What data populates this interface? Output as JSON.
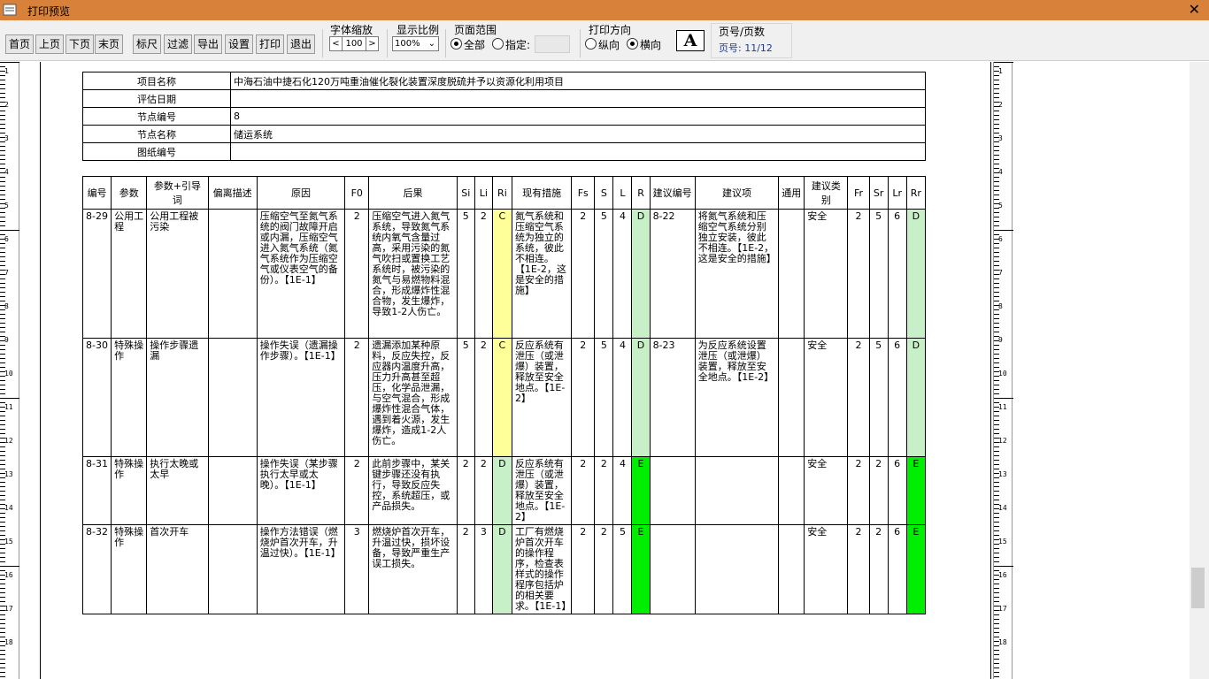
{
  "window": {
    "title": "打印预览"
  },
  "toolbar": {
    "buttons": [
      "首页",
      "上页",
      "下页",
      "末页",
      "标尺",
      "过滤",
      "导出",
      "设置",
      "打印",
      "退出"
    ],
    "font_scale_label": "字体缩放",
    "font_scale_dec": "<",
    "font_scale_value": "100",
    "font_scale_inc": ">",
    "zoom_label": "显示比例",
    "zoom_value": "100%",
    "range_label": "页面范围",
    "range_all": "全部",
    "range_spec": "指定:",
    "range_spec_value": "",
    "orient_label": "打印方向",
    "orient_portrait": "纵向",
    "orient_landscape": "横向",
    "page_label": "页号/页数",
    "page_value": "页号: 11/12",
    "font_icon": "A"
  },
  "info": [
    {
      "k": "项目名称",
      "v": "中海石油中捷石化120万吨重油催化裂化装置深度脱硫并予以资源化利用项目"
    },
    {
      "k": "评估日期",
      "v": ""
    },
    {
      "k": "节点编号",
      "v": "8"
    },
    {
      "k": "节点名称",
      "v": "储运系统"
    },
    {
      "k": "图纸编号",
      "v": ""
    }
  ],
  "columns": [
    "编号",
    "参数",
    "参数+引导词",
    "偏离描述",
    "原因",
    "F0",
    "后果",
    "Si",
    "Li",
    "Ri",
    "现有措施",
    "Fs",
    "S",
    "L",
    "R",
    "建议编号",
    "建议项",
    "通用",
    "建议类别",
    "Fr",
    "Sr",
    "Lr",
    "Rr"
  ],
  "rows": [
    {
      "id": "8-29",
      "param": "公用工程",
      "guide": "公用工程被污染",
      "dev": "",
      "cause": "压缩空气至氮气系统的阀门故障开启或内漏，压缩空气进入氮气系统（氮气系统作为压缩空气或仪表空气的备份）。【1E-1】",
      "f0": "2",
      "cons": "压缩空气进入氮气系统，导致氮气系统内氧气含量过高，采用污染的氮气吹扫或置换工艺系统时，被污染的氮气与易燃物料混合，形成爆炸性混合物，发生爆炸，导致1-2人伤亡。",
      "si": "5",
      "li": "2",
      "ri": "C",
      "meas": "氮气系统和压缩空气系统为独立的系统，彼此不相连。【1E-2，这是安全的措施】",
      "fs": "2",
      "s": "5",
      "l": "4",
      "r": "D",
      "rec_id": "8-22",
      "rec": "将氮气系统和压缩空气系统分别独立安装，彼此不相连。【1E-2，这是安全的措施】",
      "gen": "",
      "cat": "安全",
      "fr": "2",
      "sr": "5",
      "lr": "6",
      "rr": "D"
    },
    {
      "id": "8-30",
      "param": "特殊操作",
      "guide": "操作步骤遗漏",
      "dev": "",
      "cause": "操作失误（遗漏操作步骤）。【1E-1】",
      "f0": "2",
      "cons": "遗漏添加某种原料，反应失控，反应器内温度升高，压力升高甚至超压，化学品泄漏，与空气混合，形成爆炸性混合气体，遇到着火源，发生爆炸，造成1-2人伤亡。",
      "si": "5",
      "li": "2",
      "ri": "C",
      "meas": "反应系统有泄压（或泄爆）装置，释放至安全地点。【1E-2】",
      "fs": "2",
      "s": "5",
      "l": "4",
      "r": "D",
      "rec_id": "8-23",
      "rec": "为反应系统设置泄压（或泄爆）装置，释放至安全地点。【1E-2】",
      "gen": "",
      "cat": "安全",
      "fr": "2",
      "sr": "5",
      "lr": "6",
      "rr": "D"
    },
    {
      "id": "8-31",
      "param": "特殊操作",
      "guide": "执行太晚或太早",
      "dev": "",
      "cause": "操作失误（某步骤执行太早或太晚）。【1E-1】",
      "f0": "2",
      "cons": "此前步骤中，某关键步骤还没有执行，导致反应失控，系统超压，或产品损失。",
      "si": "2",
      "li": "2",
      "ri": "D",
      "meas": "反应系统有泄压（或泄爆）装置，释放至安全地点。【1E-2】",
      "fs": "2",
      "s": "2",
      "l": "4",
      "r": "E",
      "rec_id": "",
      "rec": "",
      "gen": "",
      "cat": "安全",
      "fr": "2",
      "sr": "2",
      "lr": "6",
      "rr": "E"
    },
    {
      "id": "8-32",
      "param": "特殊操作",
      "guide": "首次开车",
      "dev": "",
      "cause": "操作方法错误（燃烧炉首次开车，升温过快）。【1E-1】",
      "f0": "3",
      "cons": "燃烧炉首次开车，升温过快，损坏设备，导致严重生产误工损失。",
      "si": "2",
      "li": "3",
      "ri": "D",
      "meas": "工厂有燃烧炉首次开车的操作程序，检查表样式的操作程序包括炉的相关要求。【1E-1】",
      "fs": "2",
      "s": "2",
      "l": "5",
      "r": "E",
      "rec_id": "",
      "rec": "",
      "gen": "",
      "cat": "安全",
      "fr": "2",
      "sr": "2",
      "lr": "6",
      "rr": "E"
    }
  ],
  "ruler_numbers": [
    "1",
    "2",
    "3",
    "4",
    "5",
    "6",
    "7",
    "8",
    "9",
    "10",
    "11",
    "12",
    "13",
    "14",
    "15",
    "16",
    "17",
    "18"
  ],
  "colors": {
    "title_bar": "#d8813a",
    "ri_yellow": "#ffff99",
    "light_green": "#c8f0c8",
    "green": "#00ee00"
  }
}
